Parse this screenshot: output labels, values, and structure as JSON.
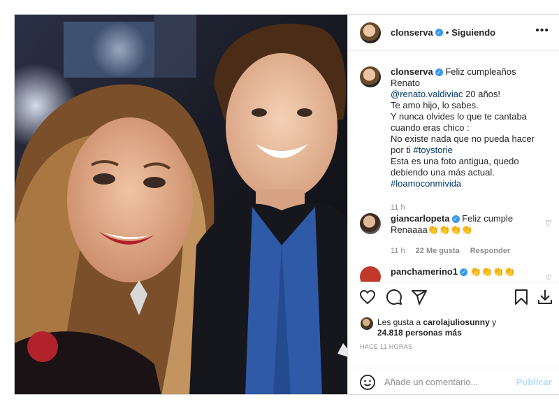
{
  "post": {
    "author": "clonserva",
    "follow_sep": "•",
    "follow_status": "Siguiendo",
    "more": "•••"
  },
  "caption": {
    "author": "clonserva",
    "line1": "Feliz cumpleaños Renato",
    "mention": "@renato.valdiviac",
    "line1b": " 20 años!",
    "line2": "Te amo hijo, lo sabes.",
    "line3": "Y nunca olvides lo que te cantaba cuando eras chico :",
    "line4": "No existe nada que no pueda hacer por ti ",
    "hashtag1": "#toystorie",
    "line5": "Esta es una foto antigua, quedo debiendo una más actual.",
    "hashtag2": "#loamoconmivida",
    "time": "11 h"
  },
  "comments": [
    {
      "user": "giancarlopeta",
      "text": "Feliz cumple Renaaaa👏👏👏👏",
      "time": "11 h",
      "likes": "22 Me gusta",
      "reply": "Responder"
    },
    {
      "user": "panchamerino1",
      "text": "👏👏👏👏"
    }
  ],
  "likes": {
    "prefix": "Les gusta a ",
    "user": "carolajuliosunny",
    "mid": " y",
    "count": "24.818 personas más"
  },
  "ago": "HACE 11 HORAS",
  "add_comment": {
    "placeholder": "Añade un comentario...",
    "publish": "Publicar"
  },
  "icons": [
    "heart-icon",
    "comment-icon",
    "share-icon",
    "bookmark-icon",
    "download-icon",
    "emoji-icon"
  ]
}
